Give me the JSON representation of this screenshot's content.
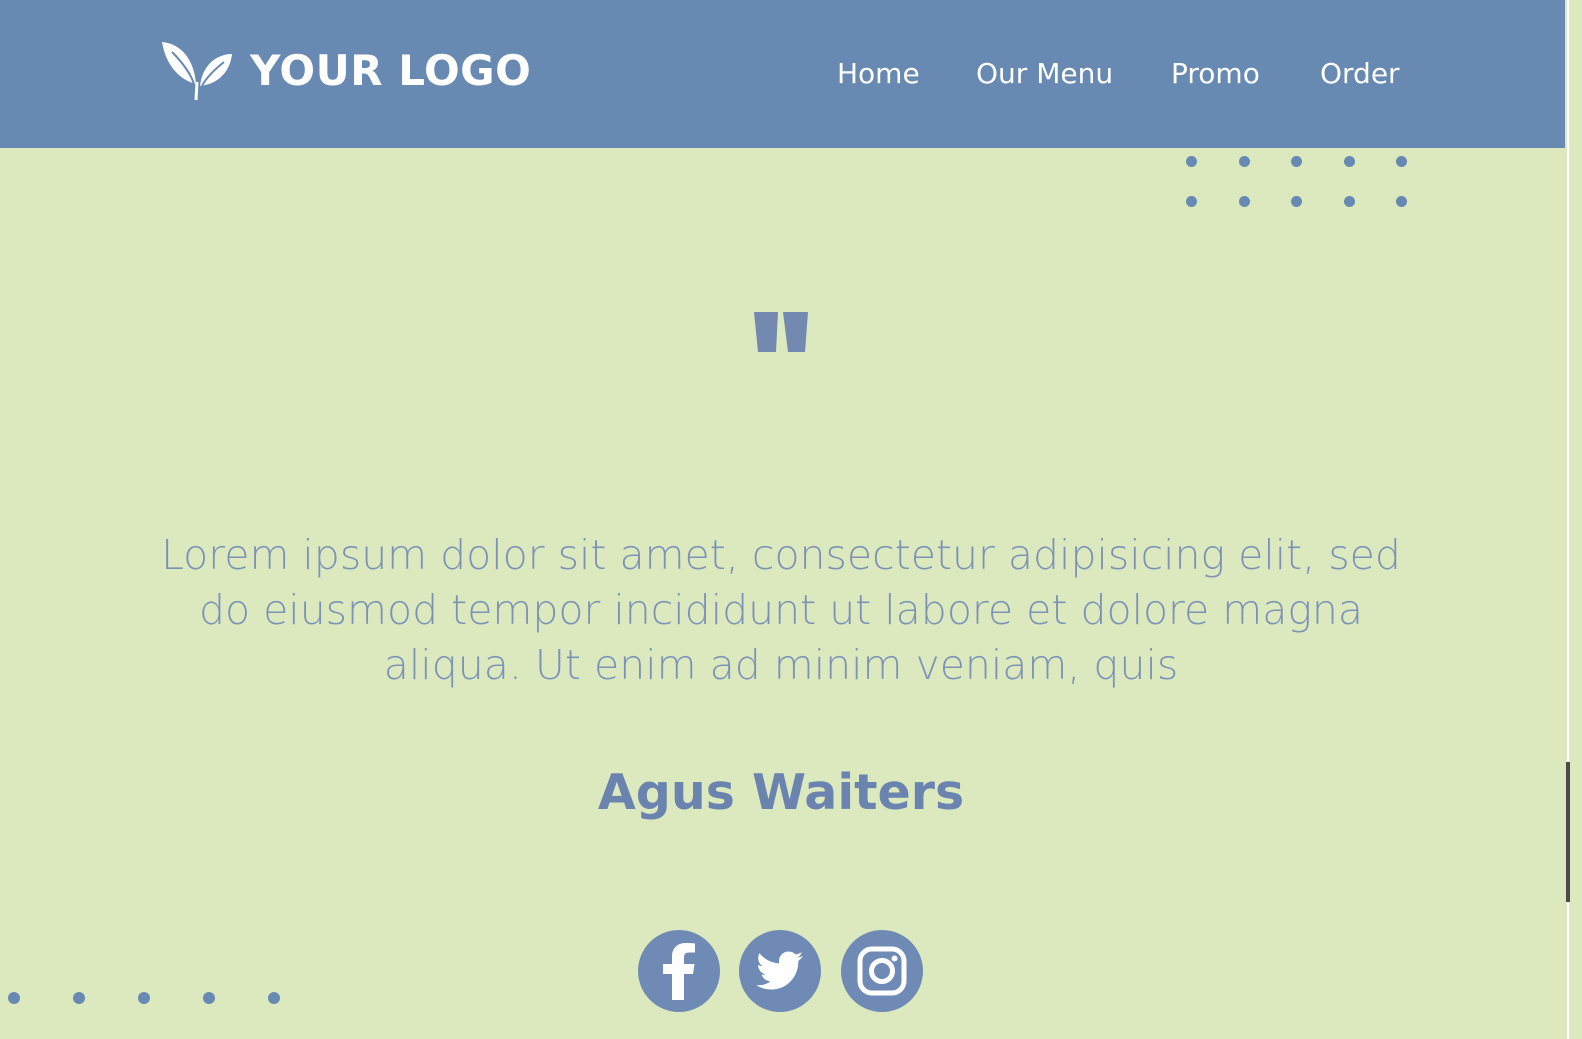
{
  "brand": {
    "logo_text": "YOUR LOGO"
  },
  "nav": {
    "items": [
      {
        "label": "Home"
      },
      {
        "label": "Our Menu"
      },
      {
        "label": "Promo"
      },
      {
        "label": "Order"
      }
    ]
  },
  "testimonial": {
    "quote_mark": "\"",
    "text": "Lorem ipsum dolor sit amet, consectetur adipisicing elit, sed do eiusmod tempor incididunt ut labore et dolore magna aliqua. Ut enim ad minim veniam, quis",
    "author": "Agus Waiters"
  },
  "social": [
    {
      "icon": "facebook-icon"
    },
    {
      "icon": "twitter-icon"
    },
    {
      "icon": "instagram-icon"
    }
  ],
  "colors": {
    "nav_bg": "#6789b2",
    "page_bg": "#dce9bf",
    "accent": "#6a83af"
  }
}
